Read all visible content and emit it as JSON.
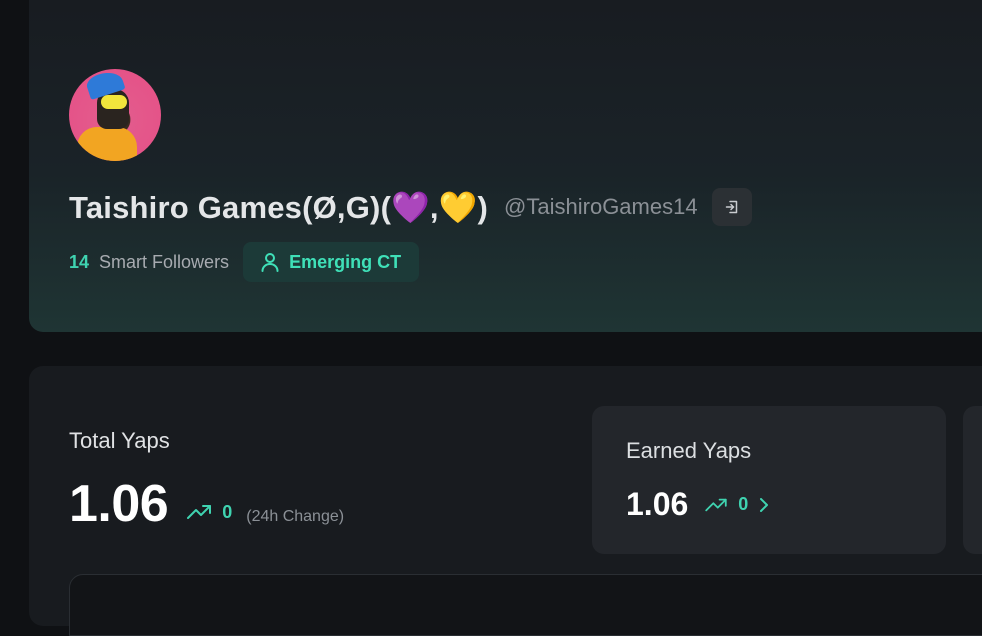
{
  "profile": {
    "display_name": "Taishiro Games(Ø,G)(💜,💛)",
    "handle": "@TaishiroGames14",
    "smart_followers_count": "14",
    "smart_followers_label": "Smart Followers",
    "badge_label": "Emerging CT",
    "icons": {
      "link": "external-link-icon",
      "badge": "user-icon"
    }
  },
  "stats": {
    "total_label": "Total Yaps",
    "total_value": "1.06",
    "total_change": "0",
    "total_change_label": "(24h Change)",
    "earned_label": "Earned Yaps",
    "earned_value": "1.06",
    "earned_change": "0"
  },
  "colors": {
    "accent": "#3fd3b0",
    "background": "#0f1114",
    "card": "#181b1f"
  }
}
